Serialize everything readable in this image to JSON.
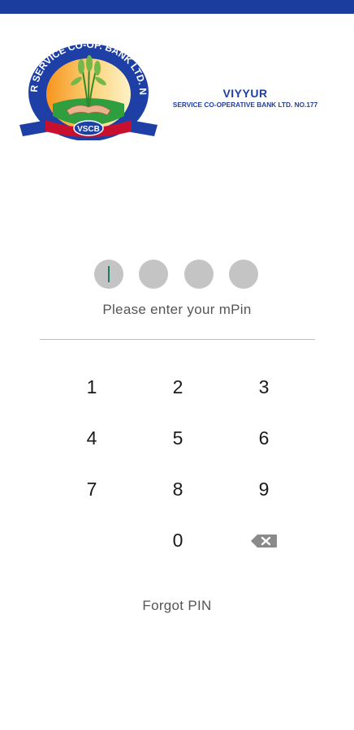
{
  "brand": {
    "name": "VIYYUR",
    "subtitle": "SERVICE CO-OPERATIVE BANK LTD. NO.177",
    "logo_ring_text": "VIYYUR SERVICE CO-OP. BANK LTD. NO.177",
    "logo_badge_text": "VSCB",
    "primary_color": "#1d3fa6",
    "status_bar_color": "#1a3d9e"
  },
  "pin": {
    "digits_total": 4,
    "digits_entered": 0,
    "prompt": "Please enter your mPin"
  },
  "keypad": {
    "keys": [
      "1",
      "2",
      "3",
      "4",
      "5",
      "6",
      "7",
      "8",
      "9",
      "",
      "0",
      "backspace-icon"
    ]
  },
  "forgot_label": "Forgot PIN"
}
